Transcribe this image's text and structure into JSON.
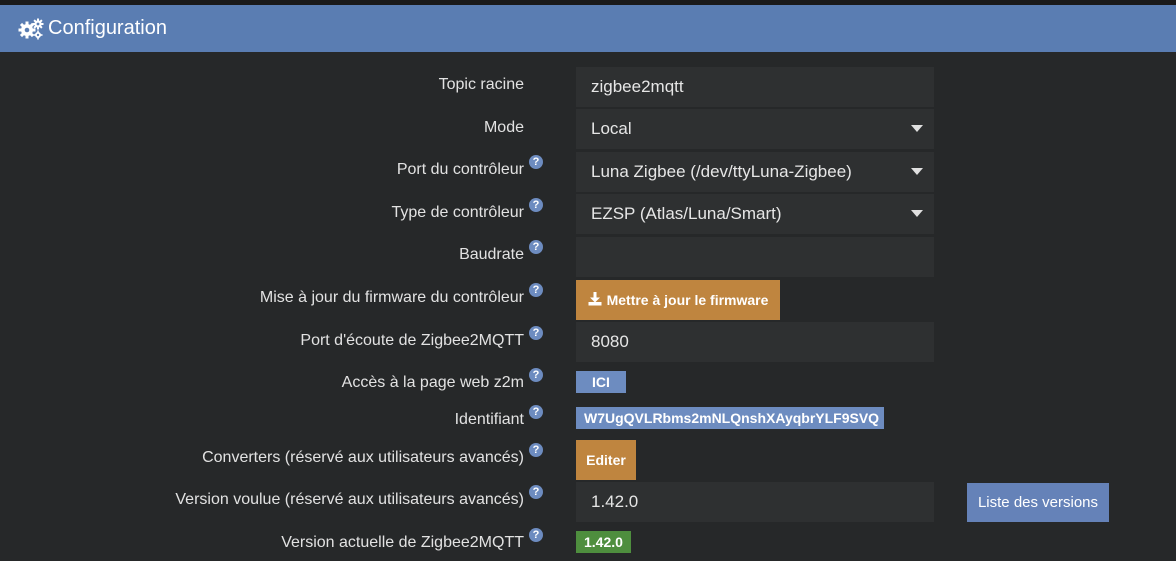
{
  "header": {
    "title": "Configuration",
    "icon": "gears-icon"
  },
  "colors": {
    "header_bg": "#5a7db2",
    "accent_orange": "#bf853f",
    "badge_blue": "#6d8cc0",
    "badge_green": "#4e8e3e",
    "field_bg": "#2e3031"
  },
  "form": {
    "topic_root": {
      "label": "Topic racine",
      "value": "zigbee2mqtt"
    },
    "mode": {
      "label": "Mode",
      "value": "Local"
    },
    "controller_port": {
      "label": "Port du contrôleur",
      "value": "Luna Zigbee (/dev/ttyLuna-Zigbee)"
    },
    "controller_type": {
      "label": "Type de contrôleur",
      "value": "EZSP (Atlas/Luna/Smart)"
    },
    "baudrate": {
      "label": "Baudrate",
      "value": ""
    },
    "firmware": {
      "label": "Mise à jour du firmware du contrôleur",
      "button": "Mettre à jour le firmware"
    },
    "listen_port": {
      "label": "Port d'écoute de Zigbee2MQTT",
      "value": "8080"
    },
    "web_access": {
      "label": "Accès à la page web z2m",
      "badge": "ICI"
    },
    "identifier": {
      "label": "Identifiant",
      "badge": "W7UgQVLRbms2mNLQnshXAyqbrYLF9SVQ"
    },
    "converters": {
      "label": "Converters (réservé aux utilisateurs avancés)",
      "button": "Editer"
    },
    "wanted_version": {
      "label": "Version voulue (réservé aux utilisateurs avancés)",
      "value": "1.42.0",
      "button": "Liste des versions"
    },
    "current_version": {
      "label": "Version actuelle de Zigbee2MQTT",
      "badge": "1.42.0"
    }
  },
  "help_glyph": "?"
}
